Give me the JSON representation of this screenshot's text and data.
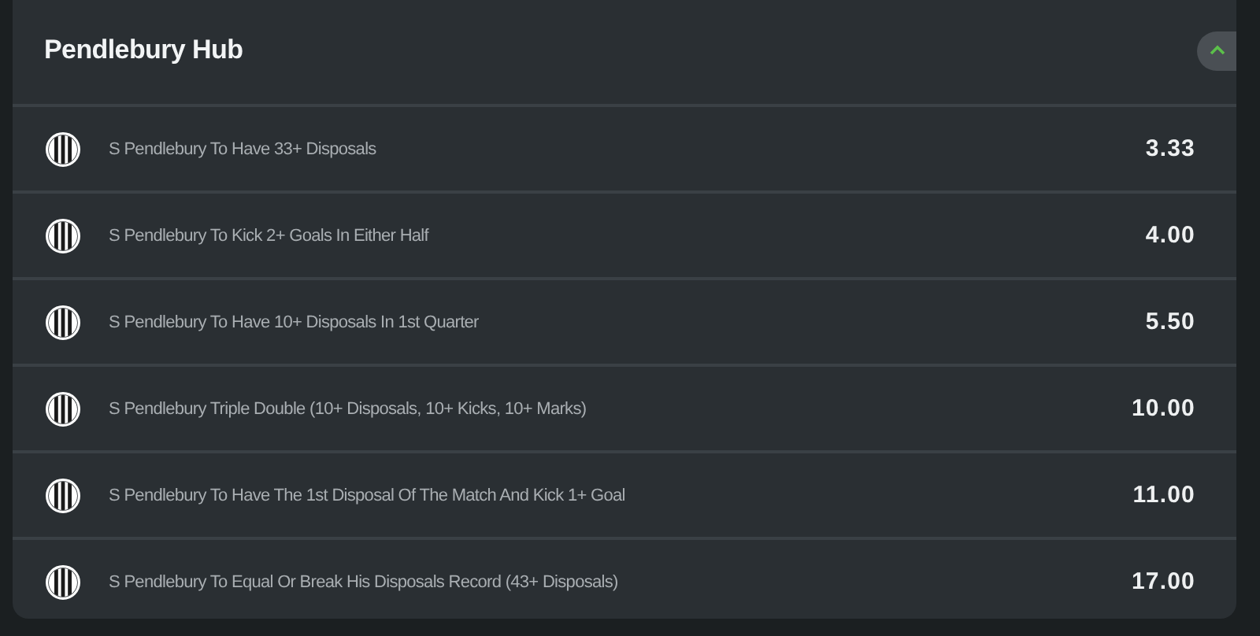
{
  "panel": {
    "title": "Pendlebury Hub",
    "expanded": true
  },
  "markets": [
    {
      "label": "S Pendlebury To Have 33+ Disposals",
      "odds": "3.33"
    },
    {
      "label": "S Pendlebury To Kick 2+ Goals In Either Half",
      "odds": "4.00"
    },
    {
      "label": "S Pendlebury To Have 10+ Disposals In 1st Quarter",
      "odds": "5.50"
    },
    {
      "label": "S Pendlebury Triple Double (10+ Disposals, 10+ Kicks, 10+ Marks)",
      "odds": "10.00"
    },
    {
      "label": "S Pendlebury To Have The 1st Disposal Of The Match And Kick 1+ Goal",
      "odds": "11.00"
    },
    {
      "label": "S Pendlebury To Equal Or Break His Disposals Record (43+ Disposals)",
      "odds": "17.00"
    }
  ]
}
